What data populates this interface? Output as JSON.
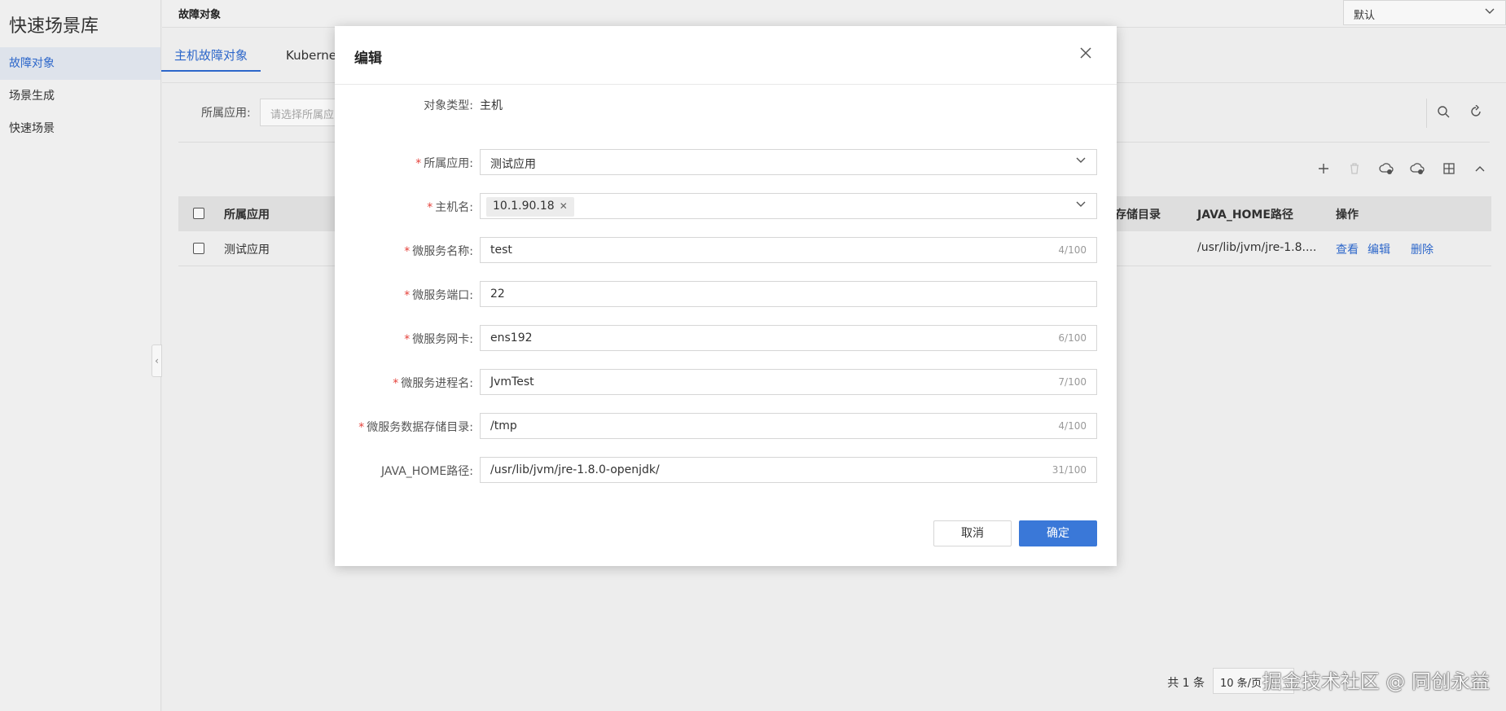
{
  "sidebar": {
    "title": "快速场景库",
    "items": [
      {
        "label": "故障对象",
        "active": true
      },
      {
        "label": "场景生成",
        "active": false
      },
      {
        "label": "快速场景",
        "active": false
      }
    ]
  },
  "header": {
    "page_title": "故障对象",
    "select_value": "默认"
  },
  "tabs": [
    {
      "label": "主机故障对象",
      "active": true
    },
    {
      "label": "Kubernet",
      "active": false
    }
  ],
  "filter": {
    "label": "所属应用:",
    "placeholder": "请选择所属应"
  },
  "table": {
    "columns": [
      "所属应用",
      "存储目录",
      "JAVA_HOME路径",
      "操作"
    ],
    "rows": [
      {
        "app": "测试应用",
        "java_home": "/usr/lib/jvm/jre-1.8....",
        "actions": [
          "查看",
          "编辑",
          "删除"
        ]
      }
    ]
  },
  "pagination": {
    "total": "共 1 条",
    "page_size": "10 条/页"
  },
  "watermark": "掘金技术社区 @ 同创永益",
  "modal": {
    "title": "编辑",
    "fields": {
      "object_type": {
        "label": "对象类型:",
        "value": "主机"
      },
      "app": {
        "label": "所属应用:",
        "value": "测试应用"
      },
      "host": {
        "label": "主机名:",
        "tag": "10.1.90.18"
      },
      "service_name": {
        "label": "微服务名称:",
        "value": "test",
        "count": "4/100"
      },
      "service_port": {
        "label": "微服务端口:",
        "value": "22"
      },
      "service_nic": {
        "label": "微服务网卡:",
        "value": "ens192",
        "count": "6/100"
      },
      "process_name": {
        "label": "微服务进程名:",
        "value": "JvmTest",
        "count": "7/100"
      },
      "data_dir": {
        "label": "微服务数据存储目录:",
        "value": "/tmp",
        "count": "4/100"
      },
      "java_home": {
        "label": "JAVA_HOME路径:",
        "value": "/usr/lib/jvm/jre-1.8.0-openjdk/",
        "count": "31/100"
      }
    },
    "required_mark": "*",
    "cancel_label": "取消",
    "ok_label": "确定"
  },
  "colors": {
    "primary": "#3a78d8",
    "required": "#e5413a",
    "link": "#2f6bd1"
  }
}
